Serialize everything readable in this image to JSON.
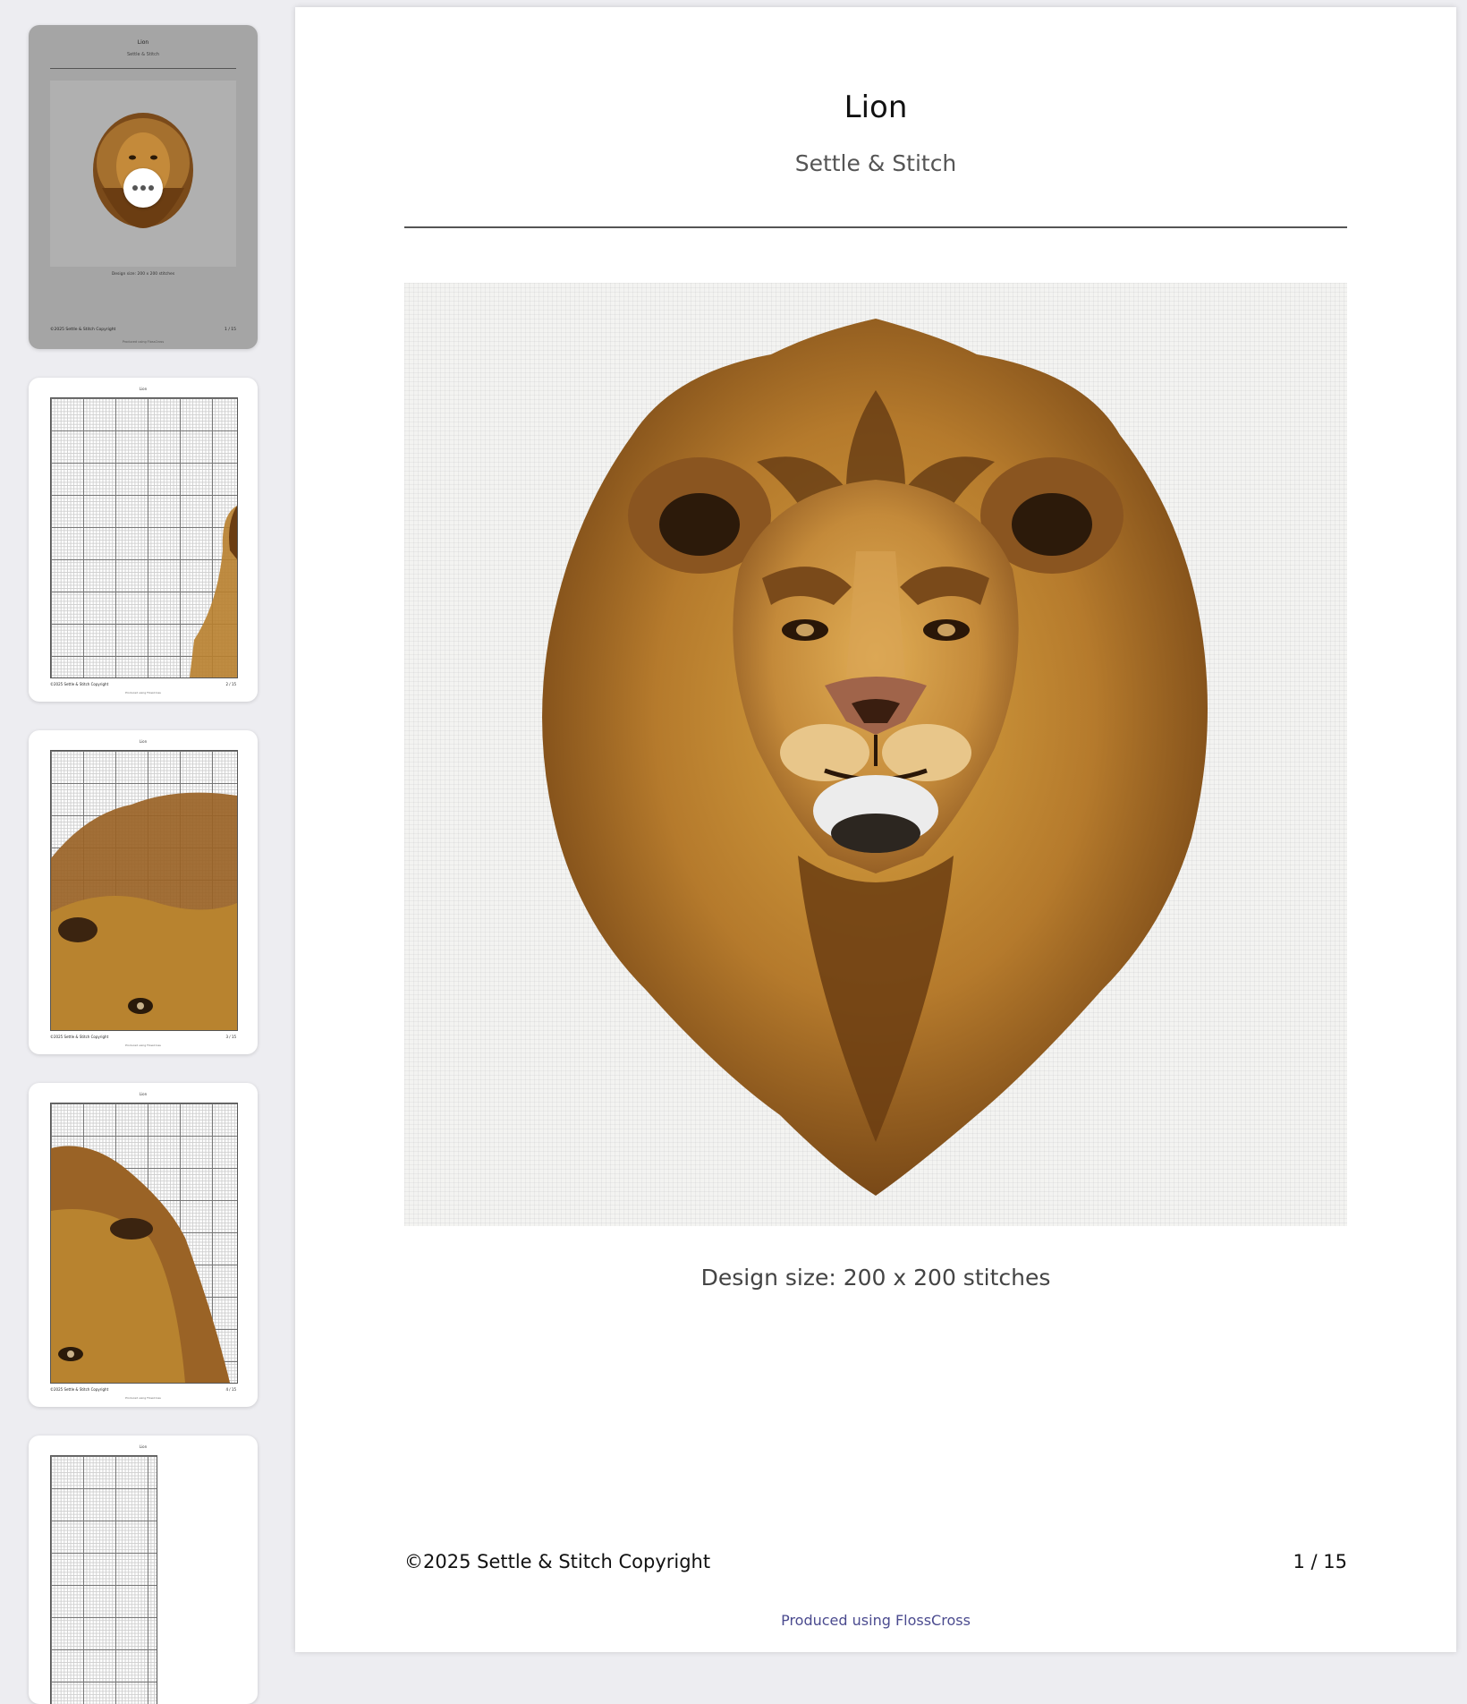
{
  "document": {
    "title": "Lion",
    "subtitle": "Settle & Stitch",
    "design_size": "Design size: 200 x 200 stitches",
    "copyright": "©2025 Settle & Stitch Copyright",
    "page_indicator": "1 / 15",
    "produced_by": "Produced using FlossCross"
  },
  "colors": {
    "background": "#ededf1",
    "page": "#ffffff",
    "active_thumbnail": "#a5a5a5",
    "link": "#4b4b8f",
    "mane_dark": "#6b3d12",
    "mane_light": "#d9a441"
  },
  "sidebar": {
    "thumbnails": [
      {
        "title": "Lion",
        "subtitle": "Settle & Stitch",
        "caption": "Design size: 200 x 200 stitches",
        "copyright": "©2025 Settle & Stitch Copyright",
        "page": "1 / 15",
        "produced": "Produced using FlossCross",
        "active": true,
        "menu_icon": "more-horizontal-icon"
      },
      {
        "title": "Lion",
        "copyright": "©2025 Settle & Stitch Copyright",
        "page": "2 / 15",
        "produced": "Produced using FlossCross"
      },
      {
        "title": "Lion",
        "copyright": "©2025 Settle & Stitch Copyright",
        "page": "3 / 15",
        "produced": "Produced using FlossCross"
      },
      {
        "title": "Lion",
        "copyright": "©2025 Settle & Stitch Copyright",
        "page": "4 / 15",
        "produced": "Produced using FlossCross"
      },
      {
        "title": "Lion"
      }
    ]
  }
}
